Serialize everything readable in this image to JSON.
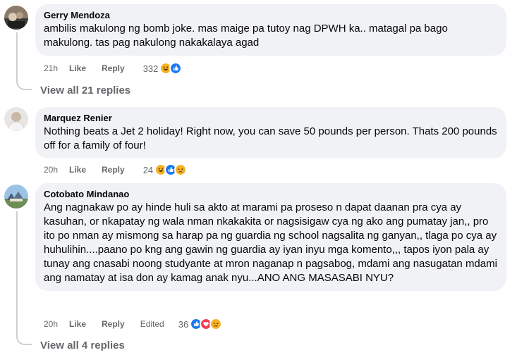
{
  "comments": [
    {
      "author": "Gerry Mendoza",
      "text": "ambilis makulong ng bomb joke. mas maige pa tutoy nag DPWH ka.. matagal pa bago makulong. tas pag nakulong nakakalaya agad",
      "time": "21h",
      "like": "Like",
      "reply": "Reply",
      "reaction_count": "332",
      "reactions": [
        "haha",
        "like"
      ],
      "view_replies": "View all 21 replies"
    },
    {
      "author": "Marquez Renier",
      "text": "Nothing beats a Jet 2 holiday! Right now, you can save 50 pounds per person. Thats 200 pounds off for a family of four!",
      "time": "20h",
      "like": "Like",
      "reply": "Reply",
      "reaction_count": "24",
      "reactions": [
        "haha",
        "like",
        "sad"
      ]
    },
    {
      "author": "Cotobato Mindanao",
      "text": "Ang nagnakaw po ay hinde huli sa akto at marami pa proseso n dapat daanan pra cya ay kasuhan, or nkapatay ng wala nman nkakakita or nagsisigaw cya ng ako ang pumatay jan,, pro ito po nman ay mismong sa harap pa ng guardia ng school nagsalita ng ganyan,, tlaga po cya ay huhulihin....paano po kng ang gawin ng guardia ay iyan inyu mga komento,,, tapos iyon pala ay tunay ang cnasabi noong studyante at mron naganap n pagsabog, mdami ang nasugatan mdami ang namatay at isa don ay kamag anak nyu...ANO ANG MASASABI NYU?",
      "time": "20h",
      "like": "Like",
      "reply": "Reply",
      "edited": "Edited",
      "reaction_count": "36",
      "reactions": [
        "like",
        "love",
        "sad"
      ],
      "view_replies": "View all 4 replies"
    }
  ],
  "colors": {
    "bubble": "#f0f2f5",
    "meta_text": "#65676b",
    "like_blue": "#1877f2",
    "love_red": "#f33e58",
    "haha_yellow": "#f7b125"
  }
}
